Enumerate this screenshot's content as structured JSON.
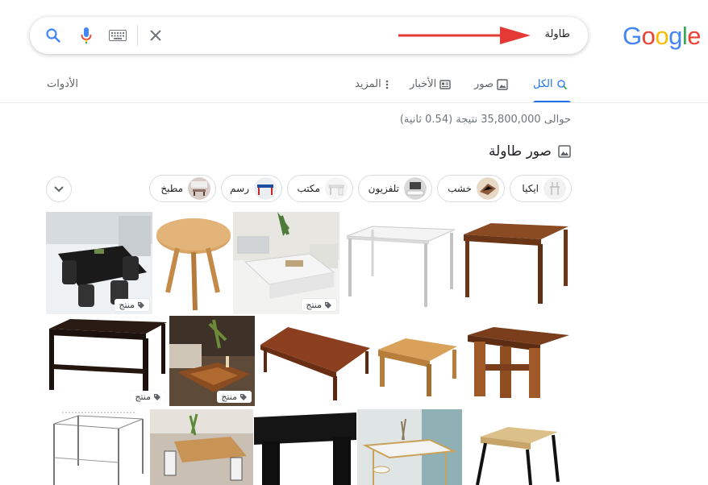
{
  "logo": {
    "letters": [
      "G",
      "o",
      "o",
      "g",
      "l",
      "e"
    ],
    "colors": [
      "#4285F4",
      "#EA4335",
      "#FBBC05",
      "#4285F4",
      "#34A853",
      "#EA4335"
    ]
  },
  "search": {
    "query": "طاولة"
  },
  "tabs": [
    {
      "label": "الكل",
      "icon": "search-icon",
      "active": true
    },
    {
      "label": "صور",
      "icon": "image-icon",
      "active": false
    },
    {
      "label": "الأخبار",
      "icon": "news-icon",
      "active": false
    },
    {
      "label": "المزيد",
      "icon": "more-vert-icon",
      "active": false
    }
  ],
  "tools_label": "الأدوات",
  "result_stats": "حوالى 35,800,000 نتيجة (0.54 ثانية)",
  "images_section": {
    "title": "صور طاولة"
  },
  "chips": [
    {
      "label": "ايكيا"
    },
    {
      "label": "خشب"
    },
    {
      "label": "تلفزيون"
    },
    {
      "label": "مكتب"
    },
    {
      "label": "رسم"
    },
    {
      "label": "مطبخ"
    }
  ],
  "product_badge": "منتج",
  "colors": {
    "accent": "#1a73e8",
    "arrow": "#e53935"
  }
}
